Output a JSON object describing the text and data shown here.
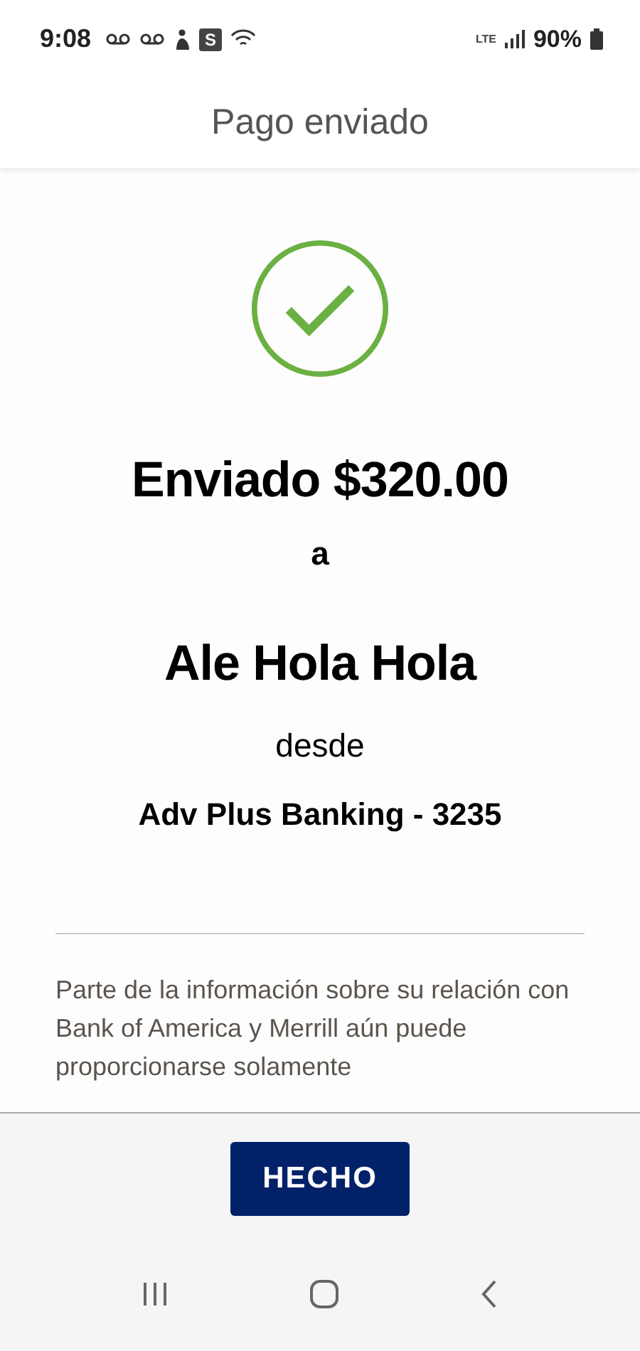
{
  "status_bar": {
    "time": "9:08",
    "app_badge": "S",
    "network": "LTE",
    "battery": "90%"
  },
  "header": {
    "title": "Pago enviado"
  },
  "confirmation": {
    "amount_line": "Enviado $320.00",
    "to_word": "a",
    "recipient": "Ale Hola Hola",
    "from_word": "desde",
    "account": "Adv Plus Banking - 3235"
  },
  "disclaimer": "Parte de la información sobre su relación con Bank of America y Merrill aún puede proporcionarse solamente",
  "buttons": [
    {
      "label": "HECHO"
    }
  ]
}
